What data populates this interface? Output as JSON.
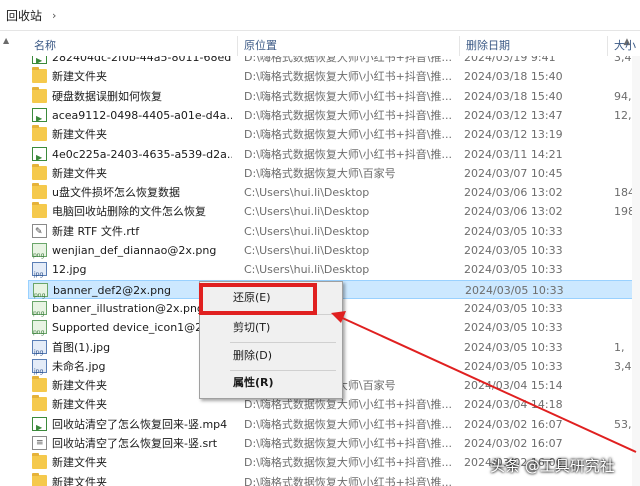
{
  "breadcrumb": {
    "location": "回收站",
    "separator": "›"
  },
  "columns": {
    "name": "名称",
    "original_location": "原位置",
    "date_deleted": "删除日期",
    "size": "大小"
  },
  "rows": [
    {
      "icon": "media-file-icon",
      "name": "282404dc-2f0b-44a5-8011-68ed...",
      "orig": "D:\\嗨格式数据恢复大师\\小红书+抖音\\推...",
      "date": "2024/03/19 9:41",
      "size": "3,4"
    },
    {
      "icon": "folder-icon",
      "name": "新建文件夹",
      "orig": "D:\\嗨格式数据恢复大师\\小红书+抖音\\推...",
      "date": "2024/03/18 15:40",
      "size": ""
    },
    {
      "icon": "folder-icon",
      "name": "硬盘数据误删如何恢复",
      "orig": "D:\\嗨格式数据恢复大师\\小红书+抖音\\推...",
      "date": "2024/03/18 15:40",
      "size": "94,0"
    },
    {
      "icon": "media-file-icon",
      "name": "acea9112-0498-4405-a01e-d4a...",
      "orig": "D:\\嗨格式数据恢复大师\\小红书+抖音\\推...",
      "date": "2024/03/12 13:47",
      "size": "12,6"
    },
    {
      "icon": "folder-icon",
      "name": "新建文件夹",
      "orig": "D:\\嗨格式数据恢复大师\\小红书+抖音\\推...",
      "date": "2024/03/12 13:19",
      "size": ""
    },
    {
      "icon": "media-file-icon",
      "name": "4e0c225a-2403-4635-a539-d2a...",
      "orig": "D:\\嗨格式数据恢复大师\\小红书+抖音\\推...",
      "date": "2024/03/11 14:21",
      "size": ""
    },
    {
      "icon": "folder-icon",
      "name": "新建文件夹",
      "orig": "D:\\嗨格式数据恢复大师\\百家号",
      "date": "2024/03/07 10:45",
      "size": ""
    },
    {
      "icon": "folder-icon",
      "name": "u盘文件损坏怎么恢复数据",
      "orig": "C:\\Users\\hui.li\\Desktop",
      "date": "2024/03/06 13:02",
      "size": "184,0"
    },
    {
      "icon": "folder-icon",
      "name": "电脑回收站删除的文件怎么恢复",
      "orig": "C:\\Users\\hui.li\\Desktop",
      "date": "2024/03/06 13:02",
      "size": "198,1"
    },
    {
      "icon": "rtf-file-icon",
      "name": "新建 RTF 文件.rtf",
      "orig": "C:\\Users\\hui.li\\Desktop",
      "date": "2024/03/05 10:33",
      "size": ""
    },
    {
      "icon": "png-file-icon",
      "name": "wenjian_def_diannao@2x.png",
      "orig": "C:\\Users\\hui.li\\Desktop",
      "date": "2024/03/05 10:33",
      "size": ""
    },
    {
      "icon": "jpg-file-icon",
      "name": "12.jpg",
      "orig": "C:\\Users\\hui.li\\Desktop",
      "date": "2024/03/05 10:33",
      "size": ""
    },
    {
      "icon": "png-file-icon",
      "name": "banner_def2@2x.png",
      "orig": "ktop",
      "date": "2024/03/05 10:33",
      "size": "",
      "selected": true
    },
    {
      "icon": "png-file-icon",
      "name": "banner_illustration@2x.png",
      "orig": "ktop",
      "date": "2024/03/05 10:33",
      "size": ""
    },
    {
      "icon": "png-file-icon",
      "name": "Supported device_icon1@2x",
      "orig": "ktop",
      "date": "2024/03/05 10:33",
      "size": ""
    },
    {
      "icon": "jpg-file-icon",
      "name": "首图(1).jpg",
      "orig": "ktop",
      "date": "2024/03/05 10:33",
      "size": "1,"
    },
    {
      "icon": "jpg-file-icon",
      "name": "未命名.jpg",
      "orig": "ktop",
      "date": "2024/03/05 10:33",
      "size": "3,4"
    },
    {
      "icon": "folder-icon",
      "name": "新建文件夹",
      "orig": "D:\\嗨格式数据恢复大师\\百家号",
      "date": "2024/03/04 15:14",
      "size": ""
    },
    {
      "icon": "folder-icon",
      "name": "新建文件夹",
      "orig": "D:\\嗨格式数据恢复大师\\小红书+抖音\\推...",
      "date": "2024/03/04 14:18",
      "size": ""
    },
    {
      "icon": "media-file-icon",
      "name": "回收站清空了怎么恢复回来-竖.mp4",
      "orig": "D:\\嗨格式数据恢复大师\\小红书+抖音\\推...",
      "date": "2024/03/02 16:07",
      "size": "53,1"
    },
    {
      "icon": "doc-file-icon",
      "name": "回收站清空了怎么恢复回来-竖.srt",
      "orig": "D:\\嗨格式数据恢复大师\\小红书+抖音\\推...",
      "date": "2024/03/02 16:07",
      "size": ""
    },
    {
      "icon": "folder-icon",
      "name": "新建文件夹",
      "orig": "D:\\嗨格式数据恢复大师\\小红书+抖音\\推...",
      "date": "2024/03/02 16:06",
      "size": ""
    },
    {
      "icon": "folder-icon",
      "name": "新建文件夹",
      "orig": "D:\\嗨格式数据恢复大师\\小红书+抖音\\推...",
      "date": "",
      "size": ""
    }
  ],
  "context_menu": {
    "restore": "还原(E)",
    "cut": "剪切(T)",
    "delete": "删除(D)",
    "properties": "属性(R)"
  },
  "colors": {
    "highlight": "#e02020",
    "selection": "#cce8ff"
  },
  "watermark": "头条 @工具研究社"
}
